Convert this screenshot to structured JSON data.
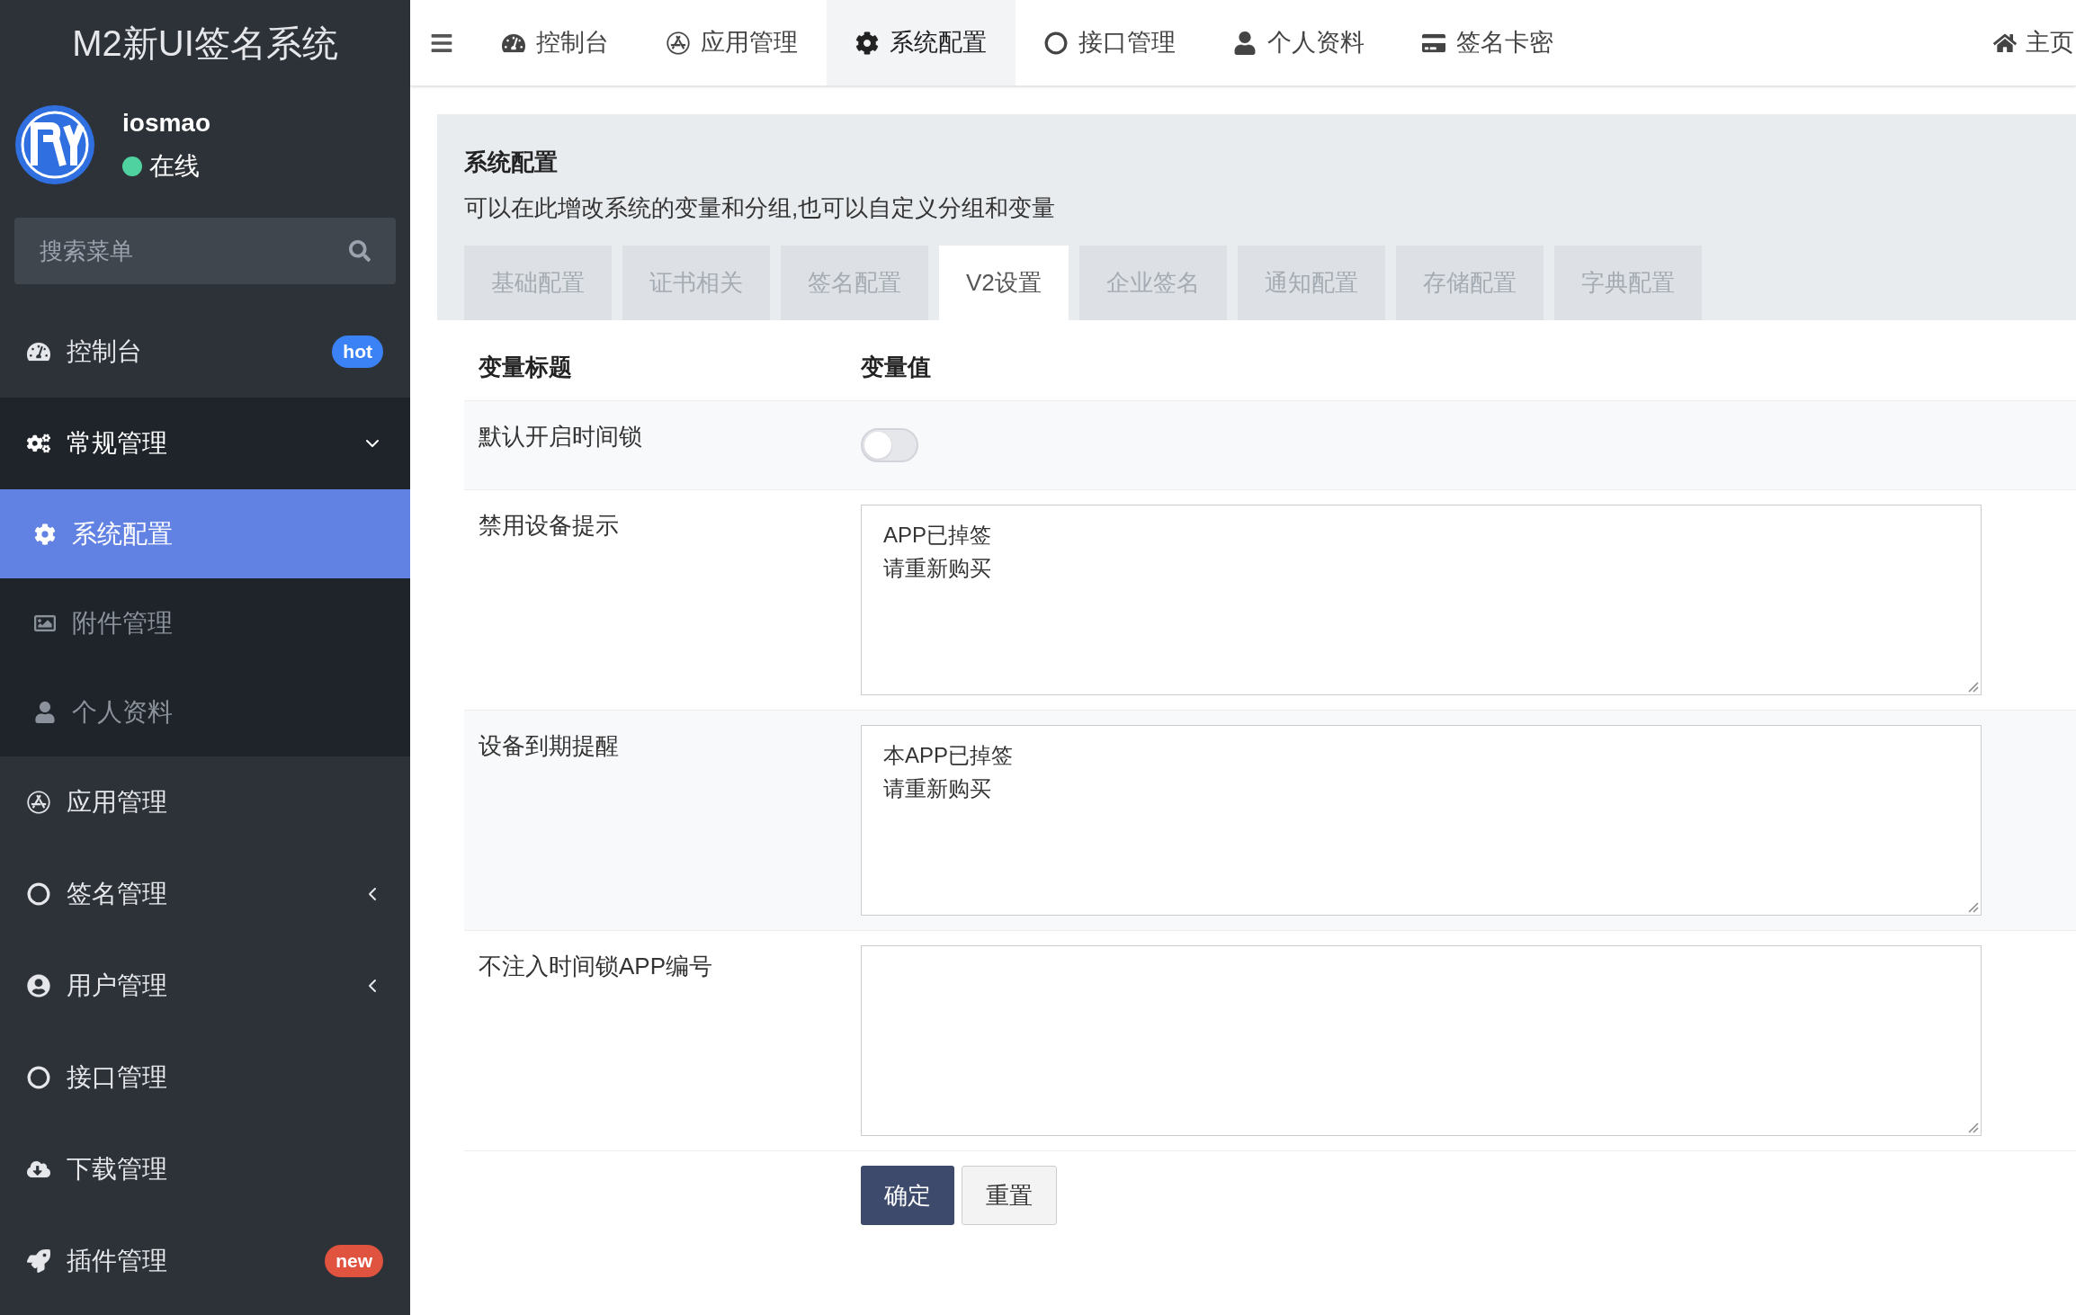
{
  "sidebar": {
    "title": "M2新UI签名系统",
    "user": {
      "name": "iosmao",
      "status": "在线"
    },
    "search": {
      "placeholder": "搜索菜单"
    },
    "items": [
      {
        "label": "控制台",
        "selected": false,
        "badge": {
          "text": "hot",
          "color": "#3b82f6"
        }
      },
      {
        "label": "常规管理",
        "selected": false,
        "expanded": true,
        "children": [
          {
            "label": "系统配置",
            "selected": true
          },
          {
            "label": "附件管理",
            "selected": false
          },
          {
            "label": "个人资料",
            "selected": false
          }
        ]
      },
      {
        "label": "应用管理",
        "selected": false
      },
      {
        "label": "签名管理",
        "selected": false,
        "expanded": false
      },
      {
        "label": "用户管理",
        "selected": false,
        "expanded": false
      },
      {
        "label": "接口管理",
        "selected": false
      },
      {
        "label": "下载管理",
        "selected": false
      },
      {
        "label": "插件管理",
        "selected": false,
        "badge": {
          "text": "new",
          "color": "#e0533f"
        }
      }
    ]
  },
  "topnav": {
    "tabs": [
      {
        "label": "控制台",
        "selected": false
      },
      {
        "label": "应用管理",
        "selected": false
      },
      {
        "label": "系统配置",
        "selected": true
      },
      {
        "label": "接口管理",
        "selected": false
      },
      {
        "label": "个人资料",
        "selected": false
      },
      {
        "label": "签名卡密",
        "selected": false
      }
    ],
    "home": "主页"
  },
  "panel": {
    "title": "系统配置",
    "description": "可以在此增改系统的变量和分组,也可以自定义分组和变量",
    "tabs": [
      {
        "label": "基础配置",
        "selected": false
      },
      {
        "label": "证书相关",
        "selected": false
      },
      {
        "label": "签名配置",
        "selected": false
      },
      {
        "label": "V2设置",
        "selected": true
      },
      {
        "label": "企业签名",
        "selected": false
      },
      {
        "label": "通知配置",
        "selected": false
      },
      {
        "label": "存储配置",
        "selected": false
      },
      {
        "label": "字典配置",
        "selected": false
      }
    ],
    "table": {
      "columns": [
        "变量标题",
        "变量值"
      ],
      "rows": [
        {
          "kind": "toggle",
          "label": "默认开启时间锁",
          "on": false
        },
        {
          "kind": "textarea",
          "label": "禁用设备提示",
          "lines": [
            "APP已掉签",
            "请重新购买"
          ]
        },
        {
          "kind": "textarea",
          "label": "设备到期提醒",
          "lines": [
            "本APP已掉签",
            "请重新购买"
          ]
        },
        {
          "kind": "textarea",
          "label": "不注入时间锁APP编号"
        }
      ]
    },
    "buttons": [
      "确定",
      "重置"
    ]
  }
}
